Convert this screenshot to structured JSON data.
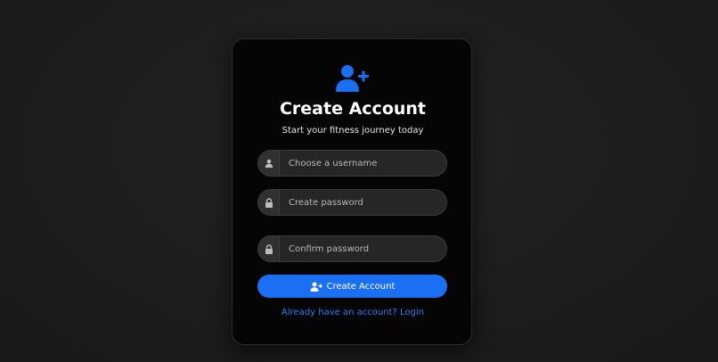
{
  "card": {
    "title": "Create Account",
    "subtitle": "Start your fitness journey today",
    "icon": "user-plus-icon"
  },
  "form": {
    "username": {
      "placeholder": "Choose a username",
      "value": "",
      "icon": "user-icon"
    },
    "password": {
      "placeholder": "Create password",
      "value": "",
      "icon": "lock-icon"
    },
    "confirm": {
      "placeholder": "Confirm password",
      "value": "",
      "icon": "lock-icon"
    },
    "submit_label": "Create Account",
    "submit_icon": "user-plus-icon"
  },
  "login_link": "Already have an account? Login",
  "colors": {
    "accent": "#1a6ff2",
    "link": "#2e7cf6",
    "card_bg": "#050505",
    "page_bg": "#1e1e1e"
  }
}
